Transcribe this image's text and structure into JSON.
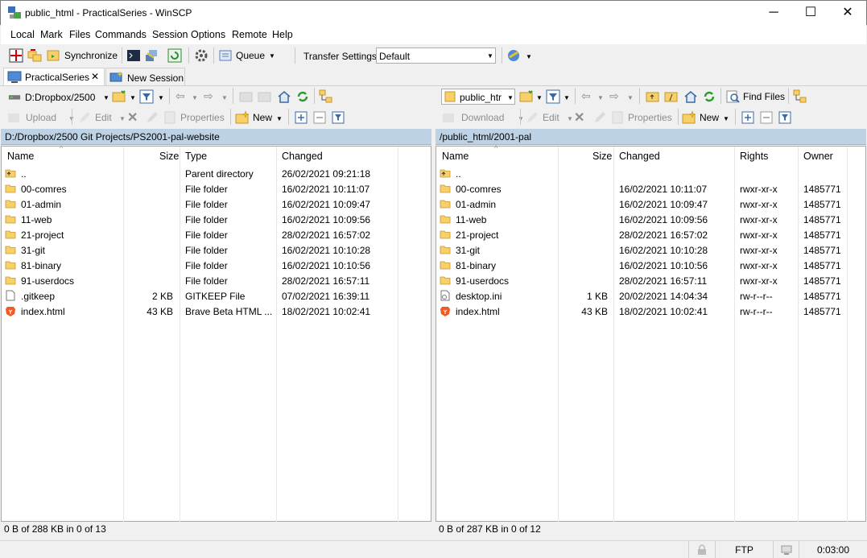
{
  "window": {
    "title": "public_html - PracticalSeries - WinSCP",
    "minimize": "─",
    "maximize": "☐",
    "close": "✕"
  },
  "menu": [
    "Local",
    "Mark",
    "Files",
    "Commands",
    "Session",
    "Options",
    "Remote",
    "Help"
  ],
  "toolbar": {
    "synchronize": "Synchronize",
    "queue": "Queue",
    "transfer_settings_label": "Transfer Settings",
    "transfer_settings_value": "Default"
  },
  "tabs": {
    "session": "PracticalSeries",
    "close": "✕",
    "new_session": "New Session"
  },
  "left": {
    "drive": "D:Dropbox/2500",
    "actions": {
      "upload": "Upload",
      "edit": "Edit",
      "properties": "Properties",
      "new": "New"
    },
    "path": "D:/Dropbox/2500 Git Projects/PS2001-pal-website",
    "columns": {
      "name": "Name",
      "size": "Size",
      "type": "Type",
      "changed": "Changed"
    },
    "rows": [
      {
        "name": "..",
        "size": "",
        "type": "Parent directory",
        "changed": "26/02/2021  09:21:18",
        "icon": "parent-dir-icon"
      },
      {
        "name": "00-comres",
        "size": "",
        "type": "File folder",
        "changed": "16/02/2021  10:11:07",
        "icon": "folder-icon"
      },
      {
        "name": "01-admin",
        "size": "",
        "type": "File folder",
        "changed": "16/02/2021  10:09:47",
        "icon": "folder-icon"
      },
      {
        "name": "11-web",
        "size": "",
        "type": "File folder",
        "changed": "16/02/2021  10:09:56",
        "icon": "folder-icon"
      },
      {
        "name": "21-project",
        "size": "",
        "type": "File folder",
        "changed": "28/02/2021  16:57:02",
        "icon": "folder-icon"
      },
      {
        "name": "31-git",
        "size": "",
        "type": "File folder",
        "changed": "16/02/2021  10:10:28",
        "icon": "folder-icon"
      },
      {
        "name": "81-binary",
        "size": "",
        "type": "File folder",
        "changed": "16/02/2021  10:10:56",
        "icon": "folder-icon"
      },
      {
        "name": "91-userdocs",
        "size": "",
        "type": "File folder",
        "changed": "28/02/2021  16:57:11",
        "icon": "folder-icon"
      },
      {
        "name": ".gitkeep",
        "size": "2 KB",
        "type": "GITKEEP File",
        "changed": "07/02/2021  16:39:11",
        "icon": "file-icon"
      },
      {
        "name": "index.html",
        "size": "43 KB",
        "type": "Brave Beta HTML ...",
        "changed": "18/02/2021  10:02:41",
        "icon": "brave-icon"
      }
    ],
    "status": "0 B of 288 KB in 0 of 13"
  },
  "right": {
    "folder": "public_htr",
    "find_files": "Find Files",
    "actions": {
      "download": "Download",
      "edit": "Edit",
      "properties": "Properties",
      "new": "New"
    },
    "path": "/public_html/2001-pal",
    "columns": {
      "name": "Name",
      "size": "Size",
      "changed": "Changed",
      "rights": "Rights",
      "owner": "Owner"
    },
    "rows": [
      {
        "name": "..",
        "size": "",
        "changed": "",
        "rights": "",
        "owner": "",
        "icon": "parent-dir-icon"
      },
      {
        "name": "00-comres",
        "size": "",
        "changed": "16/02/2021  10:11:07",
        "rights": "rwxr-xr-x",
        "owner": "1485771",
        "icon": "folder-icon"
      },
      {
        "name": "01-admin",
        "size": "",
        "changed": "16/02/2021  10:09:47",
        "rights": "rwxr-xr-x",
        "owner": "1485771",
        "icon": "folder-icon"
      },
      {
        "name": "11-web",
        "size": "",
        "changed": "16/02/2021  10:09:56",
        "rights": "rwxr-xr-x",
        "owner": "1485771",
        "icon": "folder-icon"
      },
      {
        "name": "21-project",
        "size": "",
        "changed": "28/02/2021  16:57:02",
        "rights": "rwxr-xr-x",
        "owner": "1485771",
        "icon": "folder-icon"
      },
      {
        "name": "31-git",
        "size": "",
        "changed": "16/02/2021  10:10:28",
        "rights": "rwxr-xr-x",
        "owner": "1485771",
        "icon": "folder-icon"
      },
      {
        "name": "81-binary",
        "size": "",
        "changed": "16/02/2021  10:10:56",
        "rights": "rwxr-xr-x",
        "owner": "1485771",
        "icon": "folder-icon"
      },
      {
        "name": "91-userdocs",
        "size": "",
        "changed": "28/02/2021  16:57:11",
        "rights": "rwxr-xr-x",
        "owner": "1485771",
        "icon": "folder-icon"
      },
      {
        "name": "desktop.ini",
        "size": "1 KB",
        "changed": "20/02/2021  14:04:34",
        "rights": "rw-r--r--",
        "owner": "1485771",
        "icon": "ini-file-icon"
      },
      {
        "name": "index.html",
        "size": "43 KB",
        "changed": "18/02/2021  10:02:41",
        "rights": "rw-r--r--",
        "owner": "1485771",
        "icon": "brave-icon"
      }
    ],
    "status": "0 B of 287 KB in 0 of 12"
  },
  "bottom": {
    "protocol": "FTP",
    "time": "0:03:00"
  }
}
